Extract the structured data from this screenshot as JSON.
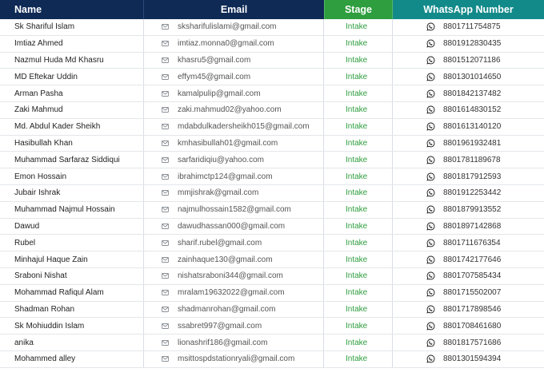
{
  "columns": {
    "name": "Name",
    "email": "Email",
    "stage": "Stage",
    "whatsapp": "WhatsApp Number"
  },
  "colors": {
    "header_navy": "#0e2a55",
    "stage_green": "#2e9e3e",
    "whatsapp_teal": "#138a8a"
  },
  "icons": {
    "email": "envelope-icon",
    "whatsapp": "whatsapp-icon"
  },
  "rows": [
    {
      "name": "Sk Shariful Islam",
      "email": "sksharifulislami@gmail.com",
      "stage": "Intake",
      "phone": "8801711754875"
    },
    {
      "name": "Imtiaz Ahmed",
      "email": "imtiaz.monna0@gmail.com",
      "stage": "Intake",
      "phone": "8801912830435"
    },
    {
      "name": "Nazmul Huda Md Khasru",
      "email": "khasru5@gmail.com",
      "stage": "Intake",
      "phone": "8801512071186"
    },
    {
      "name": "MD Eftekar Uddin",
      "email": "effym45@gmail.com",
      "stage": "Intake",
      "phone": "8801301014650"
    },
    {
      "name": "Arman Pasha",
      "email": "kamalpulip@gmail.com",
      "stage": "Intake",
      "phone": "8801842137482"
    },
    {
      "name": "Zaki Mahmud",
      "email": "zaki.mahmud02@yahoo.com",
      "stage": "Intake",
      "phone": "8801614830152"
    },
    {
      "name": "Md. Abdul Kader Sheikh",
      "email": "mdabdulkadersheikh015@gmail.com",
      "stage": "Intake",
      "phone": "8801613140120"
    },
    {
      "name": "Hasibullah Khan",
      "email": "kmhasibullah01@gmail.com",
      "stage": "Intake",
      "phone": "8801961932481"
    },
    {
      "name": "Muhammad Sarfaraz Siddiqui",
      "email": "sarfaridiqiu@yahoo.com",
      "stage": "Intake",
      "phone": "8801781189678"
    },
    {
      "name": "Emon Hossain",
      "email": "ibrahimctp124@gmail.com",
      "stage": "Intake",
      "phone": "8801817912593"
    },
    {
      "name": "Jubair Ishrak",
      "email": "mmjishrak@gmail.com",
      "stage": "Intake",
      "phone": "8801912253442"
    },
    {
      "name": "Muhammad Najmul Hossain",
      "email": "najmulhossain1582@gmail.com",
      "stage": "Intake",
      "phone": "8801879913552"
    },
    {
      "name": "Dawud",
      "email": "dawudhassan000@gmail.com",
      "stage": "Intake",
      "phone": "8801897142868"
    },
    {
      "name": "Rubel",
      "email": "sharif.rubel@gmail.com",
      "stage": "Intake",
      "phone": "8801711676354"
    },
    {
      "name": "Minhajul Haque Zain",
      "email": "zainhaque130@gmail.com",
      "stage": "Intake",
      "phone": "8801742177646"
    },
    {
      "name": "Sraboni Nishat",
      "email": "nishatsraboni344@gmail.com",
      "stage": "Intake",
      "phone": "8801707585434"
    },
    {
      "name": "Mohammad Rafiqul Alam",
      "email": "mralam19632022@gmail.com",
      "stage": "Intake",
      "phone": "8801715502007"
    },
    {
      "name": "Shadman Rohan",
      "email": "shadmanrohan@gmail.com",
      "stage": "Intake",
      "phone": "8801717898546"
    },
    {
      "name": "Sk Mohiuddin Islam",
      "email": "ssabret997@gmail.com",
      "stage": "Intake",
      "phone": "8801708461680"
    },
    {
      "name": "anika",
      "email": "lionashrif186@gmail.com",
      "stage": "Intake",
      "phone": "8801817571686"
    },
    {
      "name": "Mohammed alley",
      "email": "msittospdstationryali@gmail.com",
      "stage": "Intake",
      "phone": "8801301594394"
    }
  ]
}
